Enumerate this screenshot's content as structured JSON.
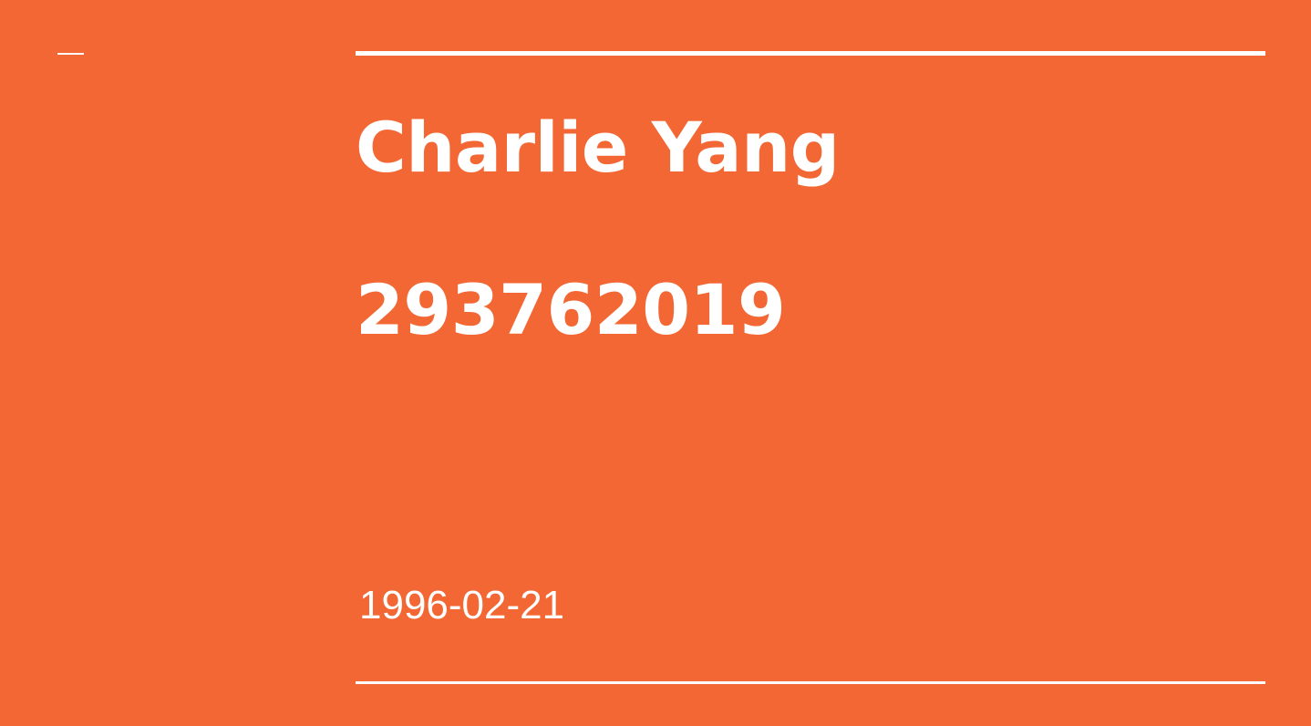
{
  "slide": {
    "title_line_1": "Charlie Yang",
    "title_line_2": "293762019",
    "subtitle": "1996-02-21"
  },
  "colors": {
    "background": "#f26734",
    "foreground": "#ffffff"
  }
}
